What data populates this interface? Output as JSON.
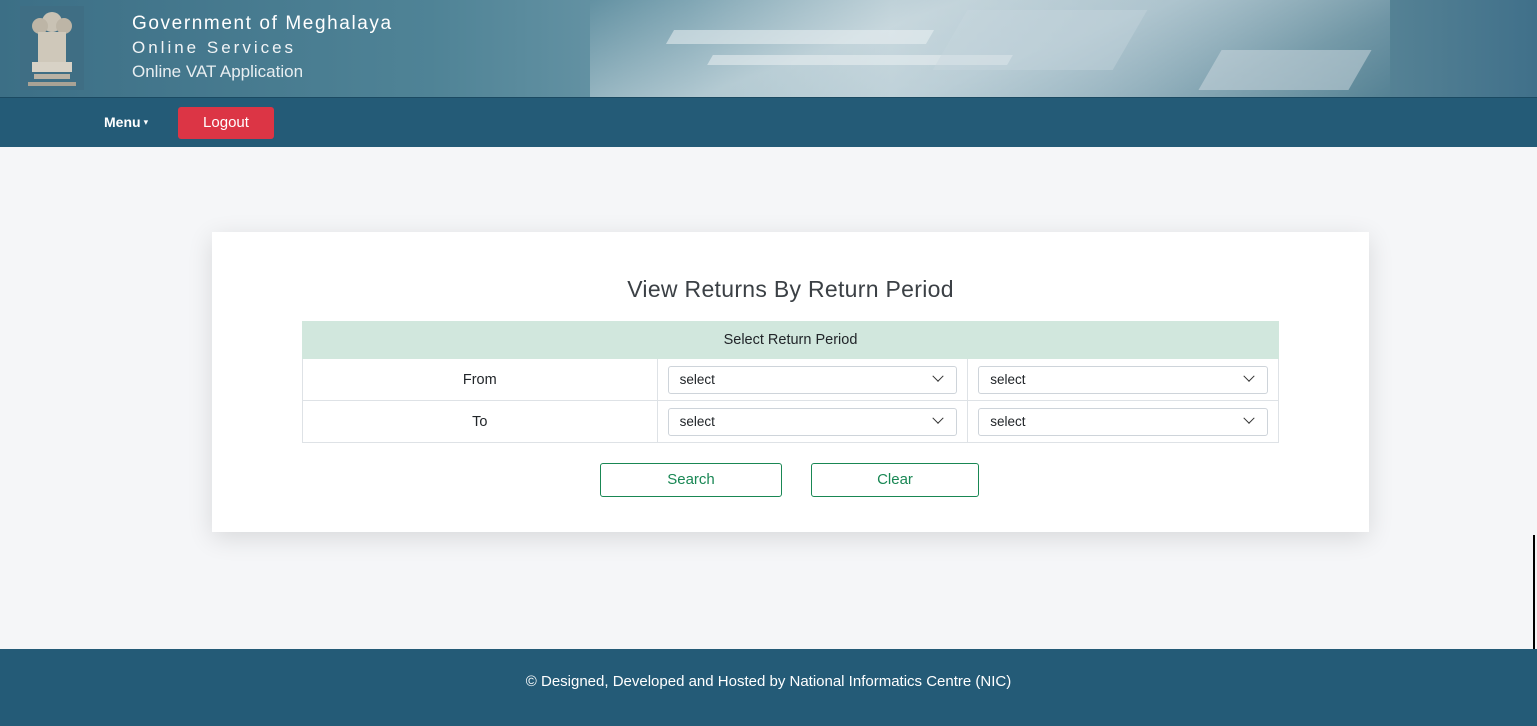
{
  "header": {
    "line1": "Government of Meghalaya",
    "line2": "Online Services",
    "line3": "Online VAT Application"
  },
  "navbar": {
    "menu_label": "Menu",
    "menu_caret": "▾",
    "logout_label": "Logout"
  },
  "form": {
    "title": "View Returns By Return Period",
    "table_header": "Select Return Period",
    "rows": [
      {
        "label": "From",
        "select1": "select",
        "select2": "select"
      },
      {
        "label": "To",
        "select1": "select",
        "select2": "select"
      }
    ],
    "search_label": "Search",
    "clear_label": "Clear"
  },
  "footer": {
    "text": "© Designed, Developed and Hosted by National Informatics Centre (NIC)"
  },
  "colors": {
    "navbar": "#245b77",
    "logout": "#dc3545",
    "table_header_bg": "#d1e7dd",
    "button_accent": "#198754"
  }
}
